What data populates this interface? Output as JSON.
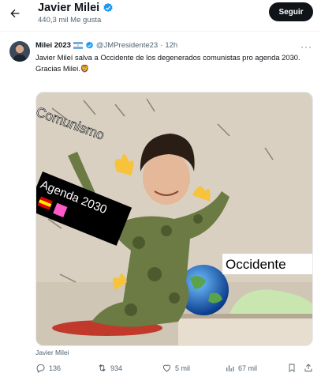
{
  "header": {
    "title": "Javier Milei",
    "subtitle": "440,3 mil Me gusta",
    "follow_label": "Seguir"
  },
  "tweet": {
    "author_name": "Milei 2023",
    "handle": "@JMPresidente23",
    "separator": "·",
    "time": "12h",
    "text": "Javier Mileí salva a Occidente de los degenerados comunistas pro agenda 2030.\nGracias Milei.🦁",
    "media_labels": {
      "comunismo": "Comunismo",
      "agenda": "Agenda 2030",
      "occidente": "Occidente"
    },
    "media_caption": "Javier Milei"
  },
  "actions": {
    "replies": "136",
    "retweets": "934",
    "likes": "5 mil",
    "views": "67 mil"
  },
  "colors": {
    "verified": "#1d9bf0",
    "text": "#0f1419",
    "muted": "#536471",
    "follow_bg": "#0f1419"
  }
}
